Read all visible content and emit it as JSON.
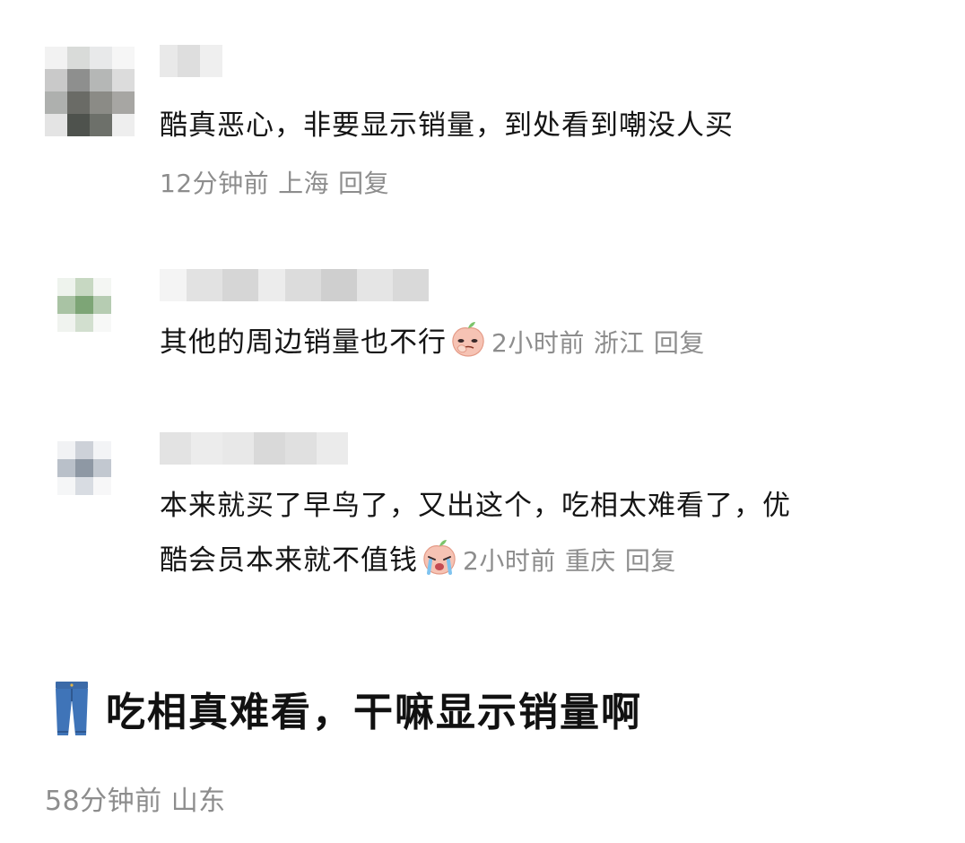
{
  "comments": [
    {
      "text": "酷真恶心，非要显示销量，到处看到嘲没人买",
      "time": "12分钟前",
      "location": "上海",
      "reply": "回复"
    },
    {
      "text": "其他的周边销量也不行",
      "emoji": "peach-smirk-emoji",
      "time": "2小时前",
      "location": "浙江",
      "reply": "回复"
    },
    {
      "text_line1": "本来就买了早鸟了，又出这个，吃相太难看了，优",
      "text_line2": "酷会员本来就不值钱",
      "emoji": "peach-crying-emoji",
      "time": "2小时前",
      "location": "重庆",
      "reply": "回复"
    }
  ],
  "post": {
    "icon": "jeans-icon",
    "title": "吃相真难看，干嘛显示销量啊",
    "time": "58分钟前",
    "location": "山东"
  }
}
